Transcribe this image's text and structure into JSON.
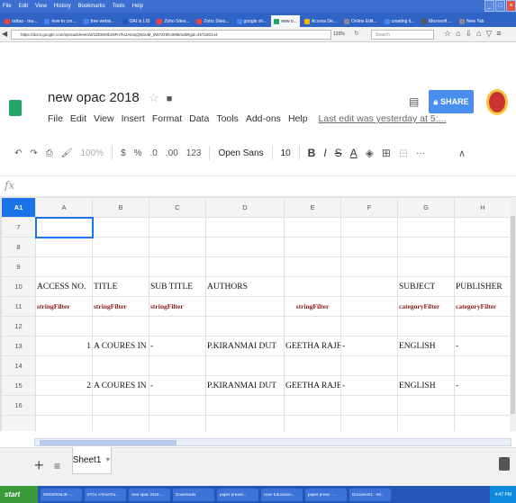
{
  "browser": {
    "menu": [
      "File",
      "Edit",
      "View",
      "History",
      "Bookmarks",
      "Tools",
      "Help"
    ],
    "tabs": [
      {
        "label": "raftaa - ma...",
        "color": "#e44"
      },
      {
        "label": "how to cre...",
        "color": "#4285f4"
      },
      {
        "label": "free websi...",
        "color": "#4285f4"
      },
      {
        "label": "OAI in LIS",
        "color": "#1e5bb8"
      },
      {
        "label": "Zoho Sites...",
        "color": "#e44"
      },
      {
        "label": "Zoho Sites...",
        "color": "#e44"
      },
      {
        "label": "google sh...",
        "color": "#4285f4"
      },
      {
        "label": "new o...",
        "color": "#23a566",
        "active": true
      },
      {
        "label": "Access De...",
        "color": "#f4b400"
      },
      {
        "label": "Online Edit...",
        "color": "#888"
      },
      {
        "label": "creating li...",
        "color": "#4285f4"
      },
      {
        "label": "Microsoft ...",
        "color": "#555"
      },
      {
        "label": "New Tab",
        "color": "#888"
      }
    ],
    "url": "https://docs.google.com/spreadsheets/d/1ZE5K0b29Fn7k1tAksqQNSuM_0W7ZHfK3MM/edit#gid=457180144",
    "zoom": "133%",
    "search_placeholder": "Search"
  },
  "doc": {
    "title": "new opac 2018",
    "menu": [
      "File",
      "Edit",
      "View",
      "Insert",
      "Format",
      "Data",
      "Tools",
      "Add-ons",
      "Help"
    ],
    "last_edit": "Last edit was yesterday at 5:...",
    "share_label": "SHARE"
  },
  "toolbar": {
    "zoom": "100%",
    "currency": "$",
    "percent": "%",
    "dec_less": ".0",
    "dec_more": ".00",
    "format": "123",
    "font": "Open Sans",
    "size": "10",
    "bold": "B",
    "italic": "I",
    "strike": "S",
    "underline": "A",
    "more": "···",
    "collapse": "∧"
  },
  "formula_bar": {
    "fx": "fx"
  },
  "grid": {
    "active_cell": "A1",
    "columns": [
      "A",
      "B",
      "C",
      "D",
      "E",
      "F",
      "G",
      "H"
    ],
    "rows": [
      {
        "n": "7",
        "cells": [
          "",
          "",
          "",
          "",
          "",
          "",
          "",
          ""
        ]
      },
      {
        "n": "8",
        "cells": [
          "",
          "",
          "",
          "",
          "",
          "",
          "",
          ""
        ]
      },
      {
        "n": "9",
        "cells": [
          "",
          "",
          "",
          "",
          "",
          "",
          "",
          ""
        ]
      },
      {
        "n": "10",
        "cells": [
          "ACCESS NO.",
          "TITLE",
          "SUB TITLE",
          "AUTHORS",
          "",
          "",
          "SUBJECT",
          "PUBLISHER"
        ]
      },
      {
        "n": "11",
        "cells": [
          "stringFilter",
          "stringFilter",
          "stringFilter",
          "",
          "stringFilter",
          "",
          "categoryFilter",
          "categoryFilter"
        ]
      },
      {
        "n": "12",
        "cells": [
          "",
          "",
          "",
          "",
          "",
          "",
          "",
          ""
        ]
      },
      {
        "n": "13",
        "cells": [
          "1",
          "A COURES IN CO",
          "-",
          "P.KIRANMAI DUT",
          "GEETHA RAJEEV",
          "-",
          "ENGLISH",
          "-"
        ]
      },
      {
        "n": "14",
        "cells": [
          "",
          "",
          "",
          "",
          "",
          "",
          "",
          ""
        ]
      },
      {
        "n": "15",
        "cells": [
          "2",
          "A COURES IN CO",
          "-",
          "P.KIRANMAI DUT",
          "GEETHA RAJEEV",
          "-",
          "ENGLISH",
          "-"
        ]
      },
      {
        "n": "16",
        "cells": [
          "",
          "",
          "",
          "",
          "",
          "",
          "",
          ""
        ]
      },
      {
        "n": "",
        "cells": [
          "",
          "",
          "",
          "",
          "",
          "",
          "",
          ""
        ]
      }
    ]
  },
  "sheets": {
    "active": "Sheet1"
  },
  "taskbar": {
    "start": "start",
    "items": [
      "MODERNLIB -...",
      "eTOL eTimeTra...",
      "new opac 2018 ...",
      "Downloads",
      "paper presen...",
      "User Education...",
      "paper prese - ...",
      "Document1 - Mi..."
    ],
    "clock": "4:47 PM"
  }
}
